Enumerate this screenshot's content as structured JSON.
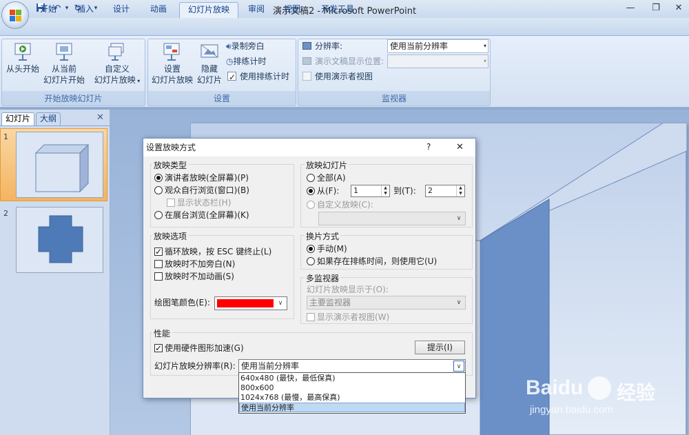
{
  "window": {
    "title": "演示文稿2 - Microsoft PowerPoint",
    "icons": [
      "save-icon",
      "undo-icon",
      "redo-icon",
      "customize-qat-icon",
      "minimize-icon",
      "restore-icon",
      "close-icon"
    ]
  },
  "ribbon": {
    "tabs": [
      "开始",
      "插入",
      "设计",
      "动画",
      "幻灯片放映",
      "审阅",
      "视图",
      "开发工具"
    ],
    "active_tab": "幻灯片放映",
    "groups": {
      "start_show": {
        "label": "开始放映幻灯片",
        "from_beginning": "从头开始",
        "from_current_1": "从当前",
        "from_current_2": "幻灯片开始",
        "custom_1": "自定义",
        "custom_2": "幻灯片放映"
      },
      "setup": {
        "label": "设置",
        "setup_show_1": "设置",
        "setup_show_2": "幻灯片放映",
        "hide_1": "隐藏",
        "hide_2": "幻灯片",
        "record_narration": "录制旁白",
        "rehearse_timings": "排练计时",
        "use_rehearsed_timings": "使用排练计时",
        "use_rehearsed_checked": true
      },
      "monitors": {
        "label": "监视器",
        "resolution_label": "分辨率:",
        "resolution_value": "使用当前分辨率",
        "show_on_label": "演示文稿显示位置:",
        "presenter_view": "使用演示者视图"
      }
    }
  },
  "left_pane": {
    "tabs": [
      "幻灯片",
      "大纲"
    ],
    "slides": [
      "1",
      "2"
    ]
  },
  "dialog": {
    "title": "设置放映方式",
    "help": "?",
    "close": "✕",
    "show_type": {
      "legend": "放映类型",
      "presenter": "演讲者放映(全屏幕)(P)",
      "browsed_window": "观众自行浏览(窗口)(B)",
      "show_status_bar": "显示状态栏(H)",
      "kiosk": "在展台浏览(全屏幕)(K)"
    },
    "show_slides": {
      "legend": "放映幻灯片",
      "all": "全部(A)",
      "from": "从(F):",
      "from_value": "1",
      "to": "到(T):",
      "to_value": "2",
      "custom": "自定义放映(C):"
    },
    "show_options": {
      "legend": "放映选项",
      "loop": "循环放映，按 ESC 键终止(L)",
      "no_narration": "放映时不加旁白(N)",
      "no_animation": "放映时不加动画(S)",
      "pen_color_label": "绘图笔颜色(E):",
      "pen_color": "#ff0000"
    },
    "advance": {
      "legend": "换片方式",
      "manual": "手动(M)",
      "use_timings": "如果存在排练时间，则使用它(U)"
    },
    "multi_monitor": {
      "legend": "多监视器",
      "display_on": "幻灯片放映显示于(O):",
      "display_value": "主要监视器",
      "presenter_view": "显示演示者视图(W)"
    },
    "performance": {
      "legend": "性能",
      "hw_accel": "使用硬件图形加速(G)",
      "tips": "提示(I)",
      "resolution_label": "幻灯片放映分辨率(R):",
      "resolution_value": "使用当前分辨率",
      "options": [
        "640x480 (最快，最低保真)",
        "800x600",
        "1024x768 (最慢，最高保真)",
        "使用当前分辨率"
      ]
    }
  },
  "watermark": {
    "brand": "Baidu",
    "cn": "经验",
    "url": "jingyan.baidu.com"
  },
  "colors": {
    "accent": "#15428b",
    "slide_bg": "#dce6f4",
    "cube": "#6b8fc7",
    "cross": "#4f7ab8"
  }
}
